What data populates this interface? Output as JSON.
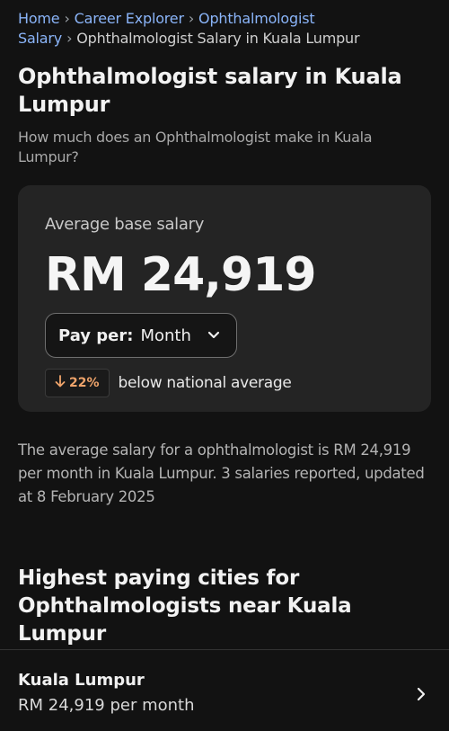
{
  "breadcrumb": {
    "home": "Home",
    "career_explorer": "Career Explorer",
    "ophthalmologist_salary": "Ophthalmologist Salary",
    "current": "Ophthalmologist Salary in Kuala Lumpur"
  },
  "header": {
    "title": "Ophthalmologist salary in Kuala Lumpur",
    "subtitle": "How much does an Ophthalmologist make in Kuala Lumpur?"
  },
  "salary_card": {
    "label": "Average base salary",
    "amount": "RM 24,919",
    "pay_per_label": "Pay per:",
    "pay_per_value": "Month",
    "badge_percent": "22%",
    "badge_color": "#f0a46b",
    "comparison_text": "below national average"
  },
  "description": "The average salary for a ophthalmologist is RM 24,919 per month in Kuala Lumpur.  3 salaries reported, updated at 8 February 2025",
  "cities_section": {
    "title": "Highest paying cities for Ophthalmologists near Kuala Lumpur",
    "cities": [
      {
        "name": "Kuala Lumpur",
        "salary": "RM 24,919 per month"
      }
    ]
  },
  "icons": {
    "dropdown": "chevron-down-icon",
    "trend": "arrow-down-icon",
    "row": "chevron-right-icon"
  }
}
